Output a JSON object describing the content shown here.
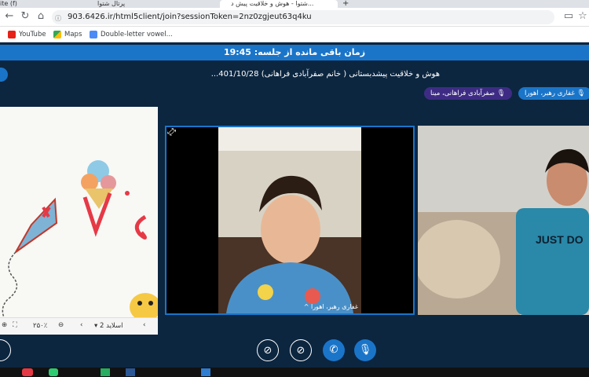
{
  "browser": {
    "tabs": [
      {
        "label": "ite (f)"
      },
      {
        "label": "پرتال شتوا"
      },
      {
        "label": "شتوا - هوش و خلاقیت پیش د..."
      }
    ],
    "url": "903.6426.ir/html5client/join?sessionToken=2nz0zgjeut63q4ku",
    "bookmarks": [
      "YouTube",
      "Maps",
      "Double-letter vowel..."
    ]
  },
  "session": {
    "timer": "زمان باقی مانده از جلسه: 19:45",
    "title": "هوش و خلاقیت پیشدبستانی ( خانم صفرآبادی فراهانی) 401/10/28...",
    "participants": [
      {
        "name": "غفاری رهبر، اهورا",
        "color": "#1a75c9"
      },
      {
        "name": "صفرآبادی فراهانی، مینا",
        "color": "#3e2c84"
      }
    ]
  },
  "whiteboard": {
    "slide_label": "اسلاید 2",
    "zoom": "۲۵۰٪"
  },
  "video": {
    "center_name": "غفاری رهبر، اهورا",
    "right_shirt_text": "JUST DO"
  },
  "controls": [
    "screen-share-off-icon",
    "video-off-icon",
    "phone-icon",
    "mic-icon"
  ]
}
